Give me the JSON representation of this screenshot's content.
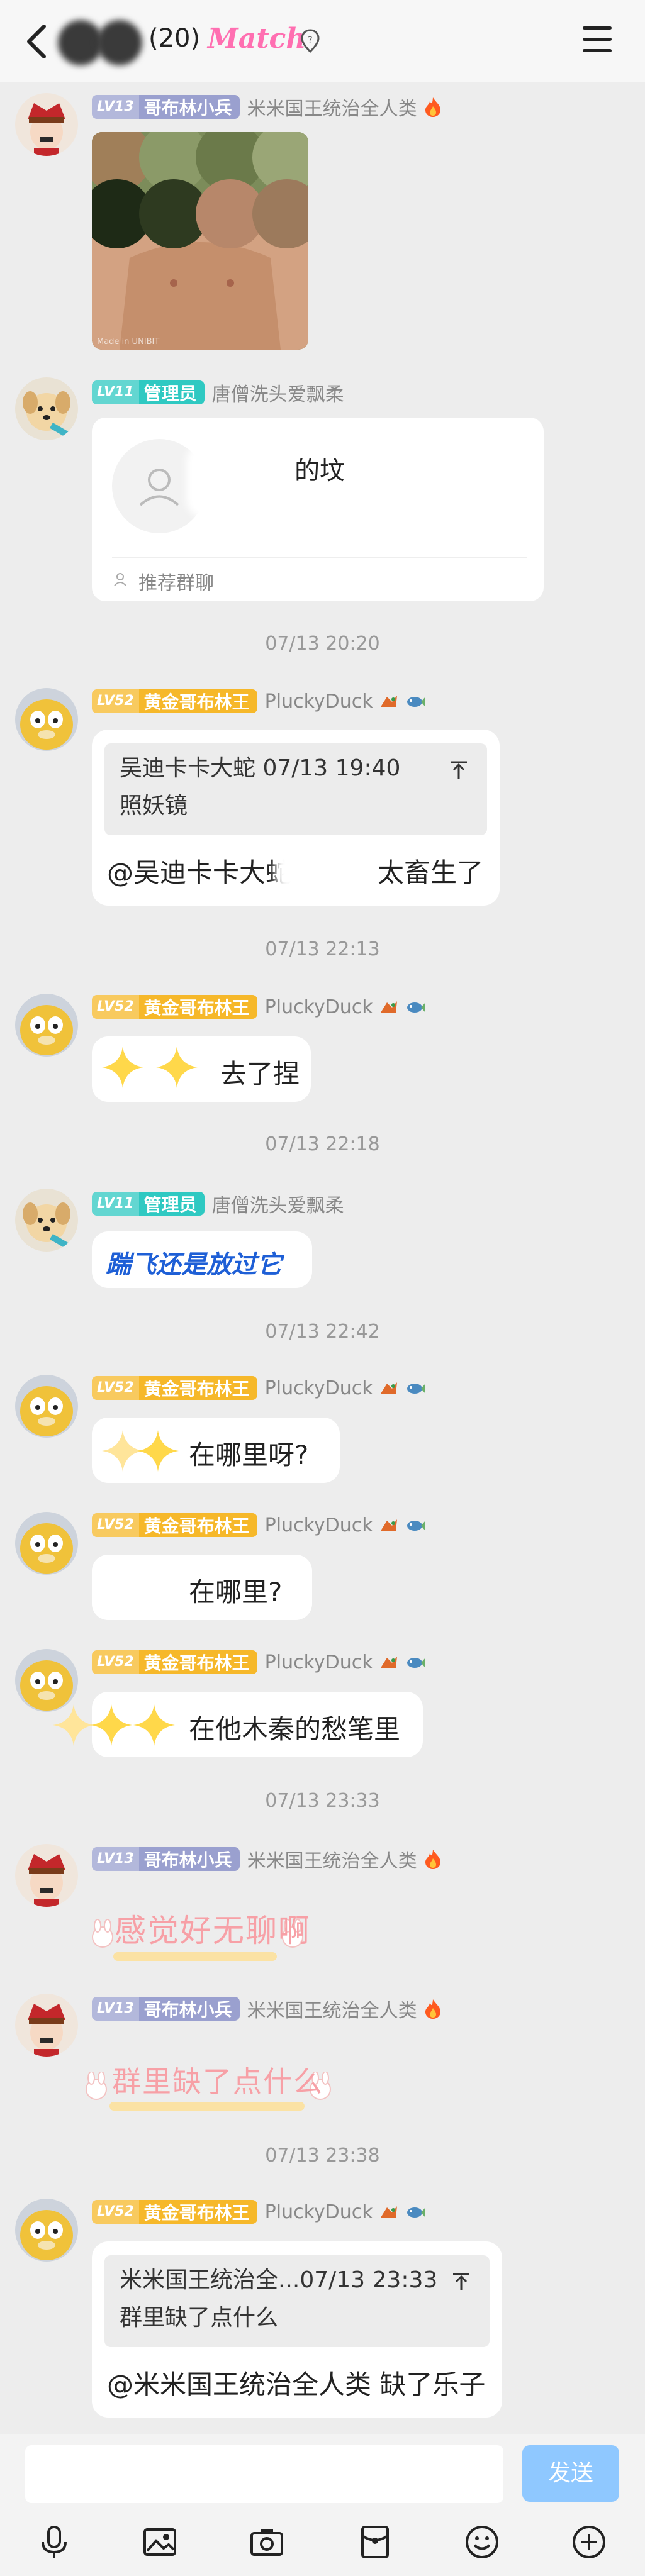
{
  "header": {
    "count": "(20)",
    "match_logo": "Match"
  },
  "messages": [
    {
      "level": "LV13",
      "title": "哥布林小兵",
      "name": "米米国王统治全人类",
      "image_caption": "Made in UNIBIT"
    },
    {
      "level": "LV11",
      "title": "管理员",
      "name": "唐僧洗头爱飘柔",
      "card_title": "的坟",
      "card_footer": "推荐群聊"
    },
    {
      "time": "07/13 20:20"
    },
    {
      "level": "LV52",
      "title": "黄金哥布林王",
      "name": "PluckyDuck",
      "quote_head": "吴迪卡卡大蛇 07/13 19:40",
      "quote_body": "照妖镜",
      "text_a": "@吴迪卡卡大蛇",
      "text_b": "太畜生了"
    },
    {
      "time": "07/13 22:13"
    },
    {
      "level": "LV52",
      "title": "黄金哥布林王",
      "name": "PluckyDuck",
      "text": "去了捏"
    },
    {
      "time": "07/13 22:18"
    },
    {
      "level": "LV11",
      "title": "管理员",
      "name": "唐僧洗头爱飘柔",
      "text": "踹飞还是放过它"
    },
    {
      "time": "07/13 22:42"
    },
    {
      "level": "LV52",
      "title": "黄金哥布林王",
      "name": "PluckyDuck",
      "text": "在哪里呀?"
    },
    {
      "level": "LV52",
      "title": "黄金哥布林王",
      "name": "PluckyDuck",
      "text": "在哪里?"
    },
    {
      "level": "LV52",
      "title": "黄金哥布林王",
      "name": "PluckyDuck",
      "text": "在他木秦的愁笔里"
    },
    {
      "time": "07/13 23:33"
    },
    {
      "level": "LV13",
      "title": "哥布林小兵",
      "name": "米米国王统治全人类",
      "sticker": "感觉好无聊啊"
    },
    {
      "level": "LV13",
      "title": "哥布林小兵",
      "name": "米米国王统治全人类",
      "sticker": "群里缺了点什么"
    },
    {
      "time": "07/13 23:38"
    },
    {
      "level": "LV52",
      "title": "黄金哥布林王",
      "name": "PluckyDuck",
      "quote_head": "米米国王统治全...07/13 23:33",
      "quote_body": "群里缺了点什么",
      "text": "@米米国王统治全人类 缺了乐子"
    }
  ],
  "composer": {
    "send_label": "发送"
  },
  "toolbar": {
    "icons": [
      "microphone-icon",
      "image-icon",
      "camera-icon",
      "red-packet-icon",
      "emoji-icon",
      "plus-icon"
    ]
  },
  "colors": {
    "background": "#ededed",
    "badge_purple": "#9aa0cf",
    "badge_teal": "#2fc9c2",
    "badge_gold": "#f6b82a",
    "send_button": "#8fc8ff",
    "match_pink": "#ff6fb1",
    "link_blue": "#1e5fd6"
  }
}
